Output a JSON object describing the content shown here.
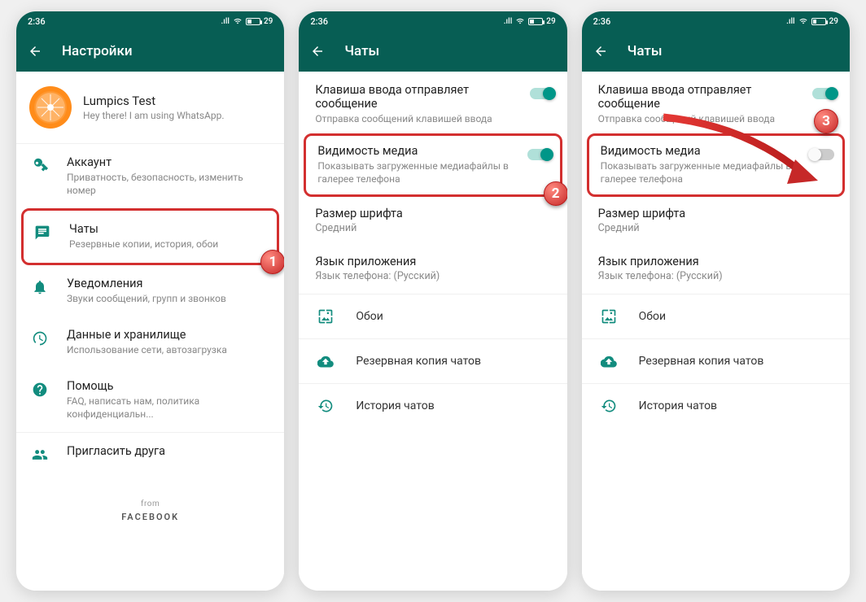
{
  "status": {
    "time": "2:36",
    "battery": "29"
  },
  "screen1": {
    "title": "Настройки",
    "profile": {
      "name": "Lumpics Test",
      "status": "Hey there! I am using WhatsApp."
    },
    "items": [
      {
        "title": "Аккаунт",
        "sub": "Приватность, безопасность, изменить номер"
      },
      {
        "title": "Чаты",
        "sub": "Резервные копии, история, обои"
      },
      {
        "title": "Уведомления",
        "sub": "Звуки сообщений, групп и звонков"
      },
      {
        "title": "Данные и хранилище",
        "sub": "Использование сети, автозагрузка"
      },
      {
        "title": "Помощь",
        "sub": "FAQ, написать нам, политика конфиденциальн..."
      },
      {
        "title": "Пригласить друга",
        "sub": ""
      }
    ],
    "from": "from",
    "facebook": "FACEBOOK"
  },
  "screen2": {
    "title": "Чаты",
    "enterKey": {
      "title": "Клавиша ввода отправляет сообщение",
      "sub": "Отправка сообщений клавишей ввода"
    },
    "mediaVis": {
      "title": "Видимость медиа",
      "sub": "Показывать загруженные медиафайлы в галерее телефона"
    },
    "fontSize": {
      "title": "Размер шрифта",
      "sub": "Средний"
    },
    "appLang": {
      "title": "Язык приложения",
      "sub": "Язык телефона: (Русский)"
    },
    "wallpaper": "Обои",
    "backup": "Резервная копия чатов",
    "history": "История чатов"
  },
  "screen3": {
    "title": "Чаты",
    "enterKey": {
      "title": "Клавиша ввода отправляет сообщение",
      "sub": "Отправка сообщений клавишей ввода"
    },
    "mediaVis": {
      "title": "Видимость медиа",
      "sub": "Показывать загруженные медиафайлы в галерее телефона"
    },
    "fontSize": {
      "title": "Размер шрифта",
      "sub": "Средний"
    },
    "appLang": {
      "title": "Язык приложения",
      "sub": "Язык телефона: (Русский)"
    },
    "wallpaper": "Обои",
    "backup": "Резервная копия чатов",
    "history": "История чатов"
  },
  "steps": {
    "s1": "1",
    "s2": "2",
    "s3": "3"
  }
}
